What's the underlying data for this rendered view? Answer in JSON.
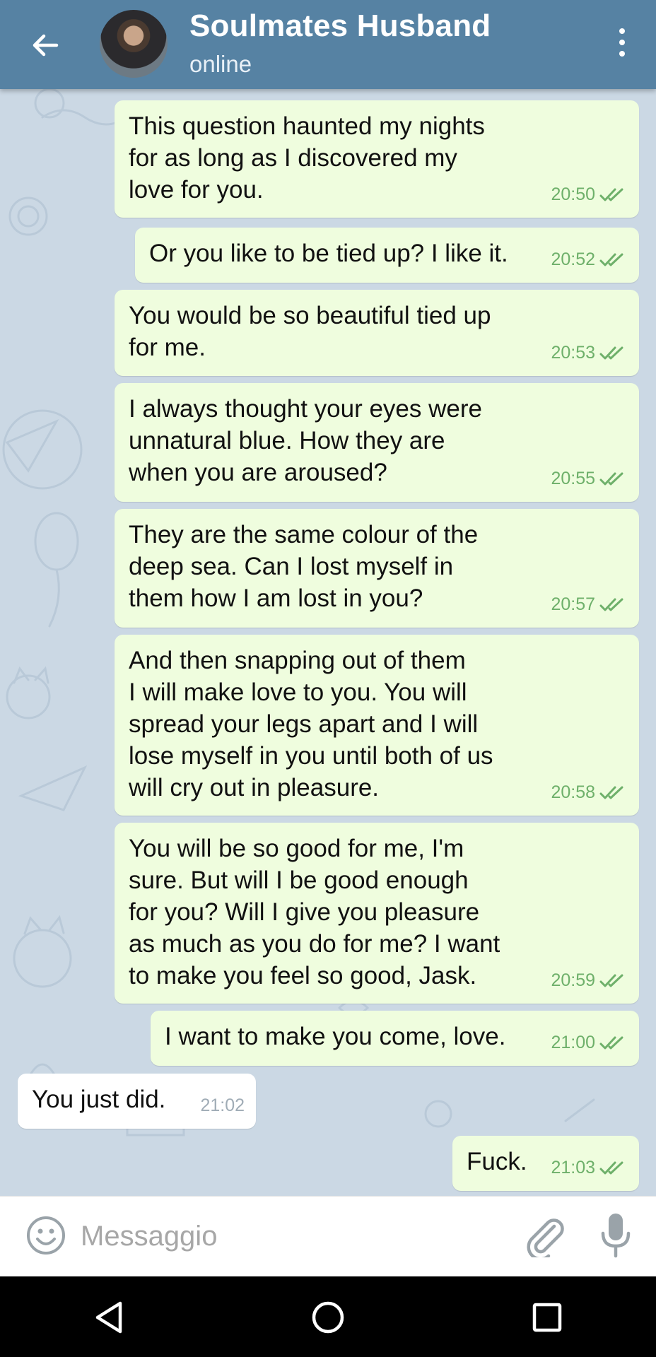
{
  "header": {
    "title": "Soulmates Husband",
    "status": "online"
  },
  "messages": [
    {
      "text": "This question haunted my nights\nfor as long as I discovered my\nlove for you.",
      "time": "20:50",
      "direction": "out"
    },
    {
      "text": "Or you like to be tied up? I like it.",
      "time": "20:52",
      "direction": "out"
    },
    {
      "text": "You would be so beautiful tied up\nfor me.",
      "time": "20:53",
      "direction": "out"
    },
    {
      "text": "I always thought your eyes were\nunnatural blue. How they are\nwhen you are aroused?",
      "time": "20:55",
      "direction": "out"
    },
    {
      "text": "They are the same colour of the\ndeep sea. Can I lost myself in\nthem how I am lost in you?",
      "time": "20:57",
      "direction": "out"
    },
    {
      "text": "And then snapping out of them\nI will make love to you. You will\nspread your legs apart and I will\nlose myself in you until both of us\nwill cry out in pleasure.",
      "time": "20:58",
      "direction": "out"
    },
    {
      "text": "You will be so good for me, I'm\nsure. But will I be good enough\nfor you? Will I give you pleasure\nas much as you do for me? I want\nto make you feel so good, Jask.",
      "time": "20:59",
      "direction": "out"
    },
    {
      "text": "I want to make you come, love.",
      "time": "21:00",
      "direction": "out"
    },
    {
      "text": "You just did.",
      "time": "21:02",
      "direction": "in"
    },
    {
      "text": "Fuck.",
      "time": "21:03",
      "direction": "out"
    }
  ],
  "input": {
    "placeholder": "Messaggio"
  },
  "icons": {
    "back": "arrow-left-icon",
    "menu": "more-vertical-icon",
    "emoji": "smile-icon",
    "attach": "paperclip-icon",
    "mic": "microphone-icon",
    "nav_back": "triangle-back-icon",
    "nav_home": "circle-home-icon",
    "nav_recents": "square-recents-icon"
  },
  "colors": {
    "header": "#5682a3",
    "outgoing_bubble": "#effdde",
    "incoming_bubble": "#ffffff",
    "check_color": "#6eb06a"
  }
}
